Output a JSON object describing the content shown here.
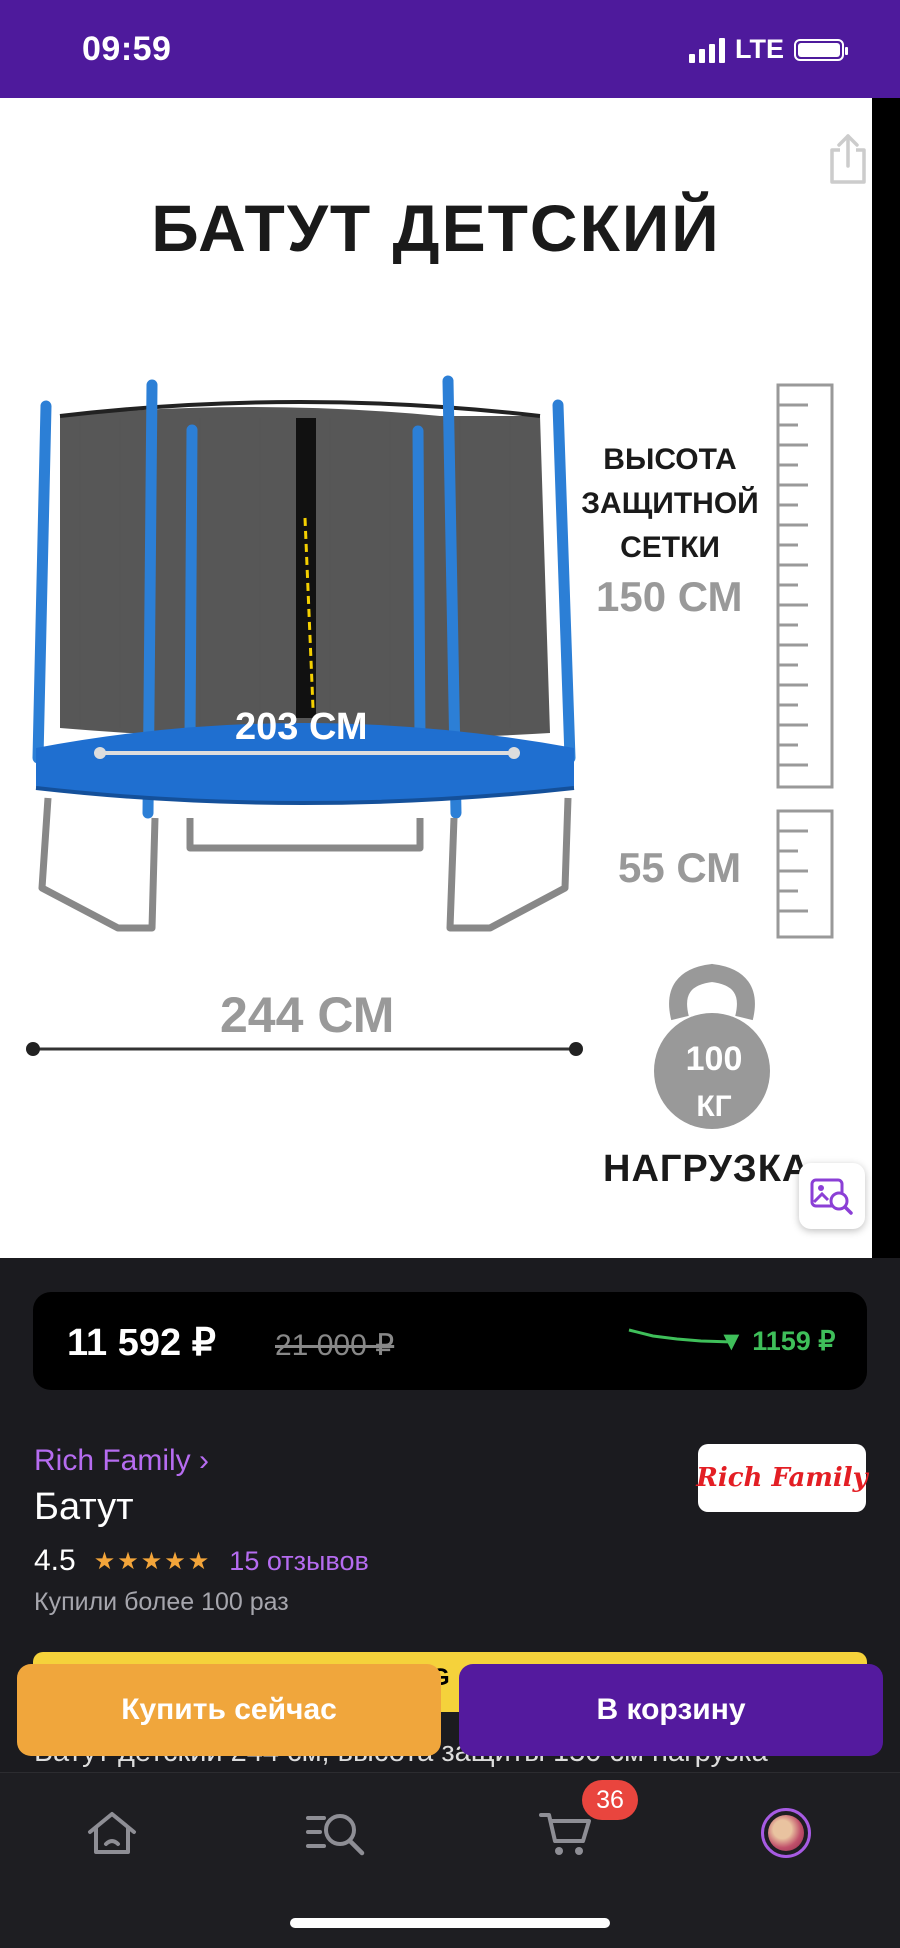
{
  "status_bar": {
    "time": "09:59",
    "network": "LTE"
  },
  "product_image": {
    "title": "БАТУТ ДЕТСКИЙ",
    "net_height_label": "ВЫСОТА ЗАЩИТНОЙ СЕТКИ",
    "net_height_value": "150 СМ",
    "leg_height_value": "55 СМ",
    "inner_diameter": "203 СМ",
    "outer_diameter": "244 СМ",
    "load_value": "100",
    "load_unit": "КГ",
    "load_label": "НАГРУЗКА"
  },
  "price": {
    "current": "11 592 ₽",
    "old": "21 000 ₽",
    "drop": "▼ 1159 ₽",
    "colors": {
      "drop": "#3fbf5a"
    }
  },
  "product": {
    "brand_link": "Rich Family ›",
    "brand_logo": "Rich Family",
    "title": "Батут",
    "rating": "4.5",
    "stars": "★★★★★",
    "reviews": "15 отзывов",
    "bought": "Купили более 100 раз",
    "description": "Батут детский 244 см, высота защиты 150 см нагрузка"
  },
  "promo": {
    "visible_text": "G"
  },
  "actions": {
    "buy_now": "Купить сейчас",
    "add_to_cart": "В корзину"
  },
  "tab_bar": {
    "items": [
      "home-icon",
      "catalog-search-icon",
      "cart-icon",
      "profile-avatar"
    ],
    "cart_badge": "36"
  },
  "colors": {
    "brand_purple": "#4e1a9c",
    "buy_orange": "#f0a63c",
    "cart_purple": "#541a9e",
    "accent_link": "#b66cf0"
  }
}
